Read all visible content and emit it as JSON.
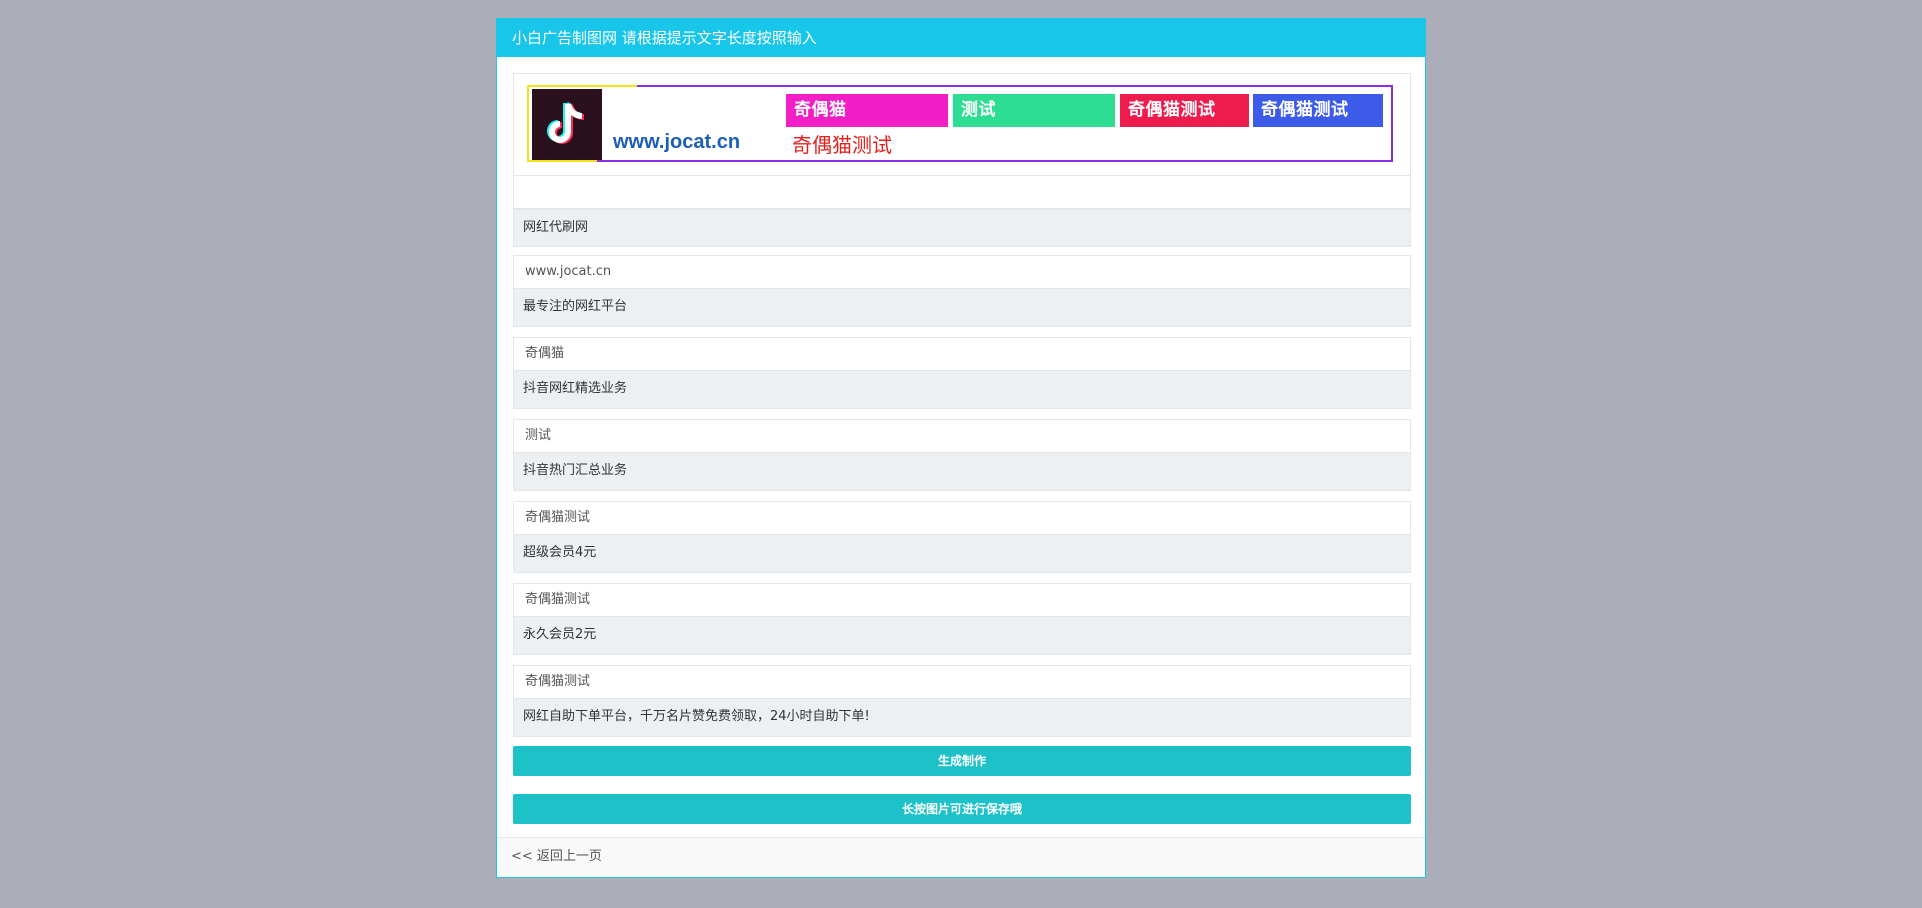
{
  "header": {
    "title": "小白广告制图网 请根据提示文字长度按照输入"
  },
  "banner": {
    "url": "www.jocat.cn",
    "subtitle": "奇偶猫测试",
    "tags": [
      {
        "text": "奇偶猫",
        "color": "#f21ec6"
      },
      {
        "text": "测试",
        "color": "#2ddd91"
      },
      {
        "text": "奇偶猫测试",
        "color": "#ee1c4d"
      },
      {
        "text": "奇偶猫测试",
        "color": "#3c5be8"
      }
    ]
  },
  "fields": [
    {
      "value": "",
      "placeholder": "网红代刷网"
    },
    {
      "value": "www.jocat.cn",
      "placeholder": "最专注的网红平台"
    },
    {
      "value": "奇偶猫",
      "placeholder": "抖音网红精选业务"
    },
    {
      "value": "测试",
      "placeholder": "抖音热门汇总业务"
    },
    {
      "value": "奇偶猫测试",
      "placeholder": "超级会员4元"
    },
    {
      "value": "奇偶猫测试",
      "placeholder": "永久会员2元"
    },
    {
      "value": "奇偶猫测试",
      "placeholder": "网红自助下单平台，千万名片赞免费领取，24小时自助下单!"
    }
  ],
  "buttons": {
    "generate": "生成制作",
    "save_hint": "长按图片可进行保存哦"
  },
  "footer": {
    "back_link": "<< 返回上一页"
  },
  "colors": {
    "accent": "#17c6e9",
    "button": "#1dc2c8"
  }
}
